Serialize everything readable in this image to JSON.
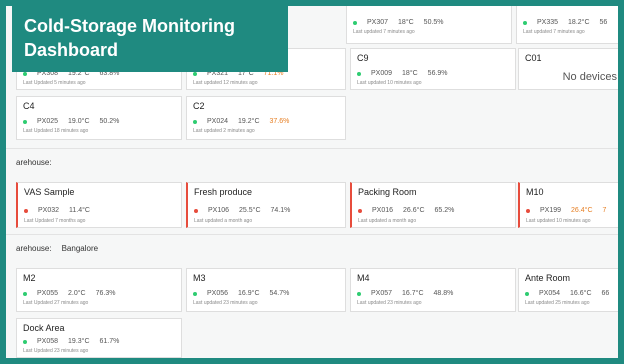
{
  "title": {
    "line1": "Cold-Storage Monitoring",
    "line2": "Dashboard"
  },
  "top_cards": [
    {
      "title": "",
      "range": "",
      "row": [
        "PX307",
        "18°C",
        "50.5%"
      ],
      "meta": "Last updated 7 minutes ago"
    },
    {
      "title": "",
      "range": "",
      "row": [
        "PX335",
        "18.2°C",
        "56"
      ],
      "meta": "Last updated 7 minutes ago"
    }
  ],
  "row1": [
    {
      "title": "",
      "range": "",
      "row": [
        "PX308",
        "19.2°C",
        "63.8%"
      ],
      "meta": "Last Updated 5 minutes ago"
    },
    {
      "title": "",
      "range": "",
      "row": [
        "PX321",
        "17°C",
        "71.1%"
      ],
      "meta": "Last updated 12 minutes ago",
      "warn": true
    },
    {
      "title": "C9",
      "range": "",
      "row": [
        "PX009",
        "18°C",
        "56.9%"
      ],
      "meta": "Last updated 10 minutes ago"
    },
    {
      "title": "C01",
      "range": "",
      "nodev": "No devices"
    }
  ],
  "row2": [
    {
      "title": "C4",
      "range": "",
      "row": [
        "PX025",
        "19.0°C",
        "50.2%"
      ],
      "meta": "Last Updated 18 minutes ago"
    },
    {
      "title": "C2",
      "range": "",
      "row": [
        "PX024",
        "19.2°C",
        "37.6%"
      ],
      "meta": "Last updated 2 minutes ago",
      "warn": true
    }
  ],
  "warehouse1": {
    "label": "arehouse:",
    "city": ""
  },
  "row3": [
    {
      "title": "VAS Sample",
      "range": "",
      "row": [
        "PX032",
        "11.4°C",
        ""
      ],
      "meta": "Last Updated 7 months ago",
      "alert": true
    },
    {
      "title": "Fresh produce",
      "range": "",
      "row": [
        "PX106",
        "25.5°C",
        "74.1%"
      ],
      "meta": "Last updated a month ago",
      "alert": true
    },
    {
      "title": "Packing Room",
      "range": "",
      "row": [
        "PX016",
        "26.6°C",
        "65.2%"
      ],
      "meta": "Last updated a month ago",
      "alert": true
    },
    {
      "title": "M10",
      "range": "",
      "row": [
        "PX199",
        "26.4°C",
        "7"
      ],
      "meta": "Last updated 10 minutes ago",
      "alert": true,
      "warn": true
    }
  ],
  "warehouse2": {
    "label": "arehouse:",
    "city": "Bangalore"
  },
  "row4": [
    {
      "title": "M2",
      "range": "",
      "row": [
        "PX055",
        "2.0°C",
        "76.3%"
      ],
      "meta": "Last Updated 27 minutes ago"
    },
    {
      "title": "M3",
      "range": "",
      "row": [
        "PX056",
        "16.9°C",
        "54.7%"
      ],
      "meta": "Last updated 23 minutes ago"
    },
    {
      "title": "M4",
      "range": "",
      "row": [
        "PX057",
        "16.7°C",
        "48.8%"
      ],
      "meta": "Last updated 23 minutes ago"
    },
    {
      "title": "Ante Room",
      "range": "",
      "row": [
        "PX054",
        "16.6°C",
        "66"
      ],
      "meta": "Last updated 25 minutes ago"
    }
  ],
  "row5": [
    {
      "title": "Dock Area",
      "range": "",
      "row": [
        "PX058",
        "19.3°C",
        "61.7%"
      ],
      "meta": "Last Updated 23 minutes ago"
    }
  ]
}
